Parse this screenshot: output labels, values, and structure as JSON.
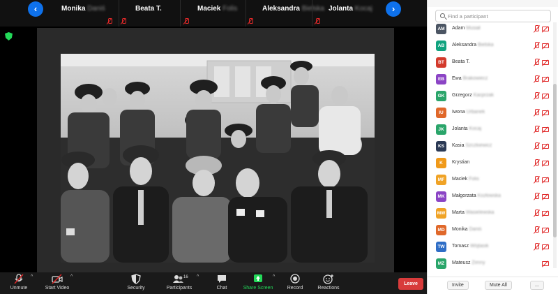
{
  "gallery": {
    "prev_arrow": "‹",
    "next_arrow": "›",
    "tiles": [
      {
        "first": "Monika",
        "last": "Daniś"
      },
      {
        "first": "Beata T.",
        "last": ""
      },
      {
        "first": "Maciek",
        "last": "Folis"
      },
      {
        "first": "Aleksandra",
        "last": "Bielska"
      },
      {
        "first": "Jolanta",
        "last": "Kocaj"
      }
    ]
  },
  "toolbar": {
    "unmute": "Unmute",
    "start_video": "Start Video",
    "security": "Security",
    "participants": "Participants",
    "participants_count": "16",
    "chat": "Chat",
    "share_screen": "Share Screen",
    "record": "Record",
    "reactions": "Reactions",
    "leave": "Leave",
    "caret": "^"
  },
  "panel": {
    "search_placeholder": "Find a participant",
    "invite": "Invite",
    "mute_all": "Mute All",
    "more": "...",
    "participants": [
      {
        "initials": "AM",
        "first": "Adam",
        "last": "Musiał",
        "color": "#4b5563"
      },
      {
        "initials": "AB",
        "first": "Aleksandra",
        "last": "Bielska",
        "color": "#10a37f"
      },
      {
        "initials": "BT",
        "first": "Beata T.",
        "last": "",
        "color": "#d33a2c"
      },
      {
        "initials": "EB",
        "first": "Ewa",
        "last": "Brakowiecz",
        "color": "#8b44c5"
      },
      {
        "initials": "GK",
        "first": "Grzegorz",
        "last": "Kacprzak",
        "color": "#2aa56a"
      },
      {
        "initials": "IU",
        "first": "Iwona",
        "last": "Urbanek",
        "color": "#e0682a"
      },
      {
        "initials": "JK",
        "first": "Jolanta",
        "last": "Kocaj",
        "color": "#2aa56a"
      },
      {
        "initials": "KS",
        "first": "Kasia",
        "last": "Szczkiewicz",
        "color": "#2b3a55"
      },
      {
        "initials": "K",
        "first": "Krystian",
        "last": "",
        "color": "#f09a1a"
      },
      {
        "initials": "MF",
        "first": "Maciek",
        "last": "Folis",
        "color": "#f0a326"
      },
      {
        "initials": "MK",
        "first": "Małgorzata",
        "last": "Kozłowska",
        "color": "#8b44c5"
      },
      {
        "initials": "MW",
        "first": "Marta",
        "last": "Wasielewska",
        "color": "#f0a326"
      },
      {
        "initials": "MD",
        "first": "Monika",
        "last": "Daniś",
        "color": "#e0682a"
      },
      {
        "initials": "TW",
        "first": "Tomasz",
        "last": "Wójtasik",
        "color": "#2f6ec6"
      },
      {
        "initials": "MZ",
        "first": "Mateusz",
        "last": "Zimny",
        "color": "#2aa56a"
      }
    ]
  }
}
